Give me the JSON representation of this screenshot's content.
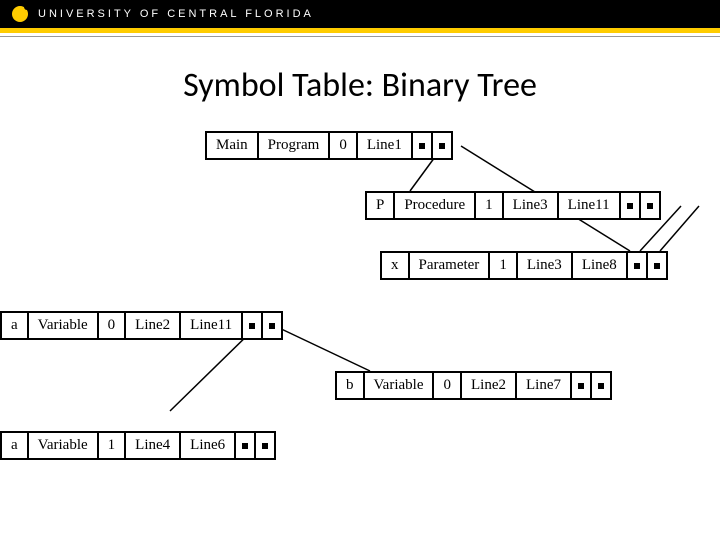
{
  "header": {
    "university": "UNIVERSITY OF CENTRAL FLORIDA"
  },
  "title": "Symbol Table: Binary Tree",
  "nodes": {
    "main": {
      "name": "Main",
      "kind": "Program",
      "scope": "0",
      "decl": "Line1",
      "use": ""
    },
    "p": {
      "name": "P",
      "kind": "Procedure",
      "scope": "1",
      "decl": "Line3",
      "use": "Line11"
    },
    "x": {
      "name": "x",
      "kind": "Parameter",
      "scope": "1",
      "decl": "Line3",
      "use": "Line8"
    },
    "a0": {
      "name": "a",
      "kind": "Variable",
      "scope": "0",
      "decl": "Line2",
      "use": "Line11"
    },
    "b": {
      "name": "b",
      "kind": "Variable",
      "scope": "0",
      "decl": "Line2",
      "use": "Line7"
    },
    "a1": {
      "name": "a",
      "kind": "Variable",
      "scope": "1",
      "decl": "Line4",
      "use": "Line6"
    }
  }
}
